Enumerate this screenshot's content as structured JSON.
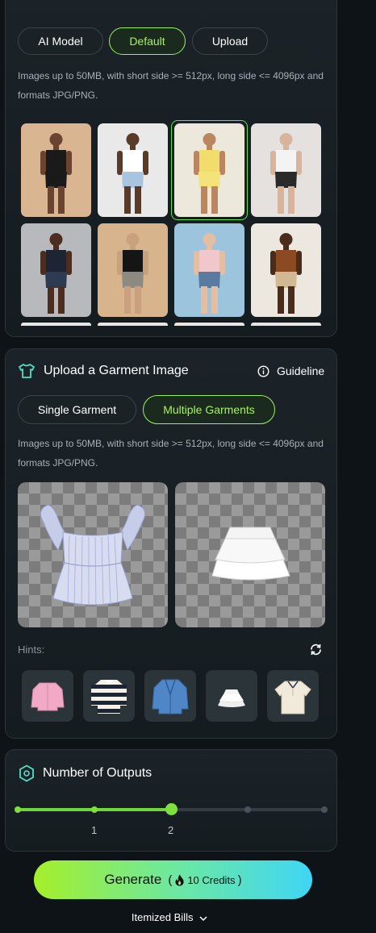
{
  "model_panel": {
    "tabs": [
      {
        "label": "AI Model",
        "active": false
      },
      {
        "label": "Default",
        "active": true
      },
      {
        "label": "Upload",
        "active": false
      }
    ],
    "note": "Images up to 50MB, with short side >= 512px, long side <= 4096px and formats JPG/PNG.",
    "models": [
      {
        "bg": "#d9b592",
        "top": "#1a1a1a",
        "bottom": "#1a1a1a",
        "skin": "#6b4430",
        "selected": false
      },
      {
        "bg": "#e9e9ea",
        "top": "#ffffff",
        "bottom": "#a9c4de",
        "skin": "#5a3a28",
        "selected": false
      },
      {
        "bg": "#ece9dc",
        "top": "#f1dc6c",
        "bottom": "#f4e37a",
        "skin": "#b98660",
        "selected": true
      },
      {
        "bg": "#e4e1de",
        "top": "#f3f3f3",
        "bottom": "#2a2a2a",
        "skin": "#d8b49c",
        "selected": false
      },
      {
        "bg": "#b7b9bd",
        "top": "#1d2433",
        "bottom": "#2c3a52",
        "skin": "#4b2e20",
        "selected": false
      },
      {
        "bg": "#d8b48d",
        "top": "#151515",
        "bottom": "#8e8a82",
        "skin": "#caa17f",
        "selected": false
      },
      {
        "bg": "#9dc4dd",
        "top": "#f2c7cb",
        "bottom": "#5b7aa0",
        "skin": "#e3bea2",
        "selected": false
      },
      {
        "bg": "#ece7df",
        "top": "#8b4a22",
        "bottom": "#d2b893",
        "skin": "#4a2c1d",
        "selected": false
      }
    ]
  },
  "garment_panel": {
    "title": "Upload a Garment Image",
    "guideline_label": "Guideline",
    "tabs": [
      {
        "label": "Single Garment",
        "active": false
      },
      {
        "label": "Multiple Garments",
        "active": true
      }
    ],
    "note": "Images up to 50MB, with short side >= 512px, long side <= 4096px and formats JPG/PNG.",
    "hints_label": "Hints:",
    "hints": [
      "pink-denim-jacket",
      "striped-rugby-shirt",
      "blue-cardigan",
      "white-mini-skirt",
      "cream-polo-shirt"
    ]
  },
  "outputs_panel": {
    "title": "Number of Outputs",
    "value": 2,
    "ticks": [
      "1",
      "2"
    ],
    "steps": 5
  },
  "generate": {
    "label": "Generate",
    "credits": "10 Credits"
  },
  "bills_label": "Itemized Bills"
}
